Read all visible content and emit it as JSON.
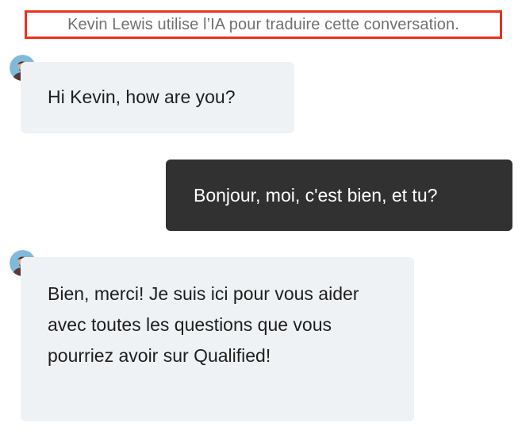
{
  "notice": {
    "text": "Kevin Lewis utilise l’IA pour traduire cette conversation."
  },
  "messages": [
    {
      "from": "agent",
      "text": "Hi Kevin, how are you?"
    },
    {
      "from": "user",
      "text": "Bonjour, moi, c'est bien, et tu?"
    },
    {
      "from": "agent",
      "text": "Bien, merci! Je suis ici pour vous aider avec toutes les questions que vous pourriez avoir sur Qualified!"
    }
  ],
  "colors": {
    "notice_border": "#e8321e",
    "incoming_bubble": "#eff2f5",
    "outgoing_bubble": "#313131"
  },
  "icons": {
    "agent_avatar": "agent-avatar-icon"
  }
}
